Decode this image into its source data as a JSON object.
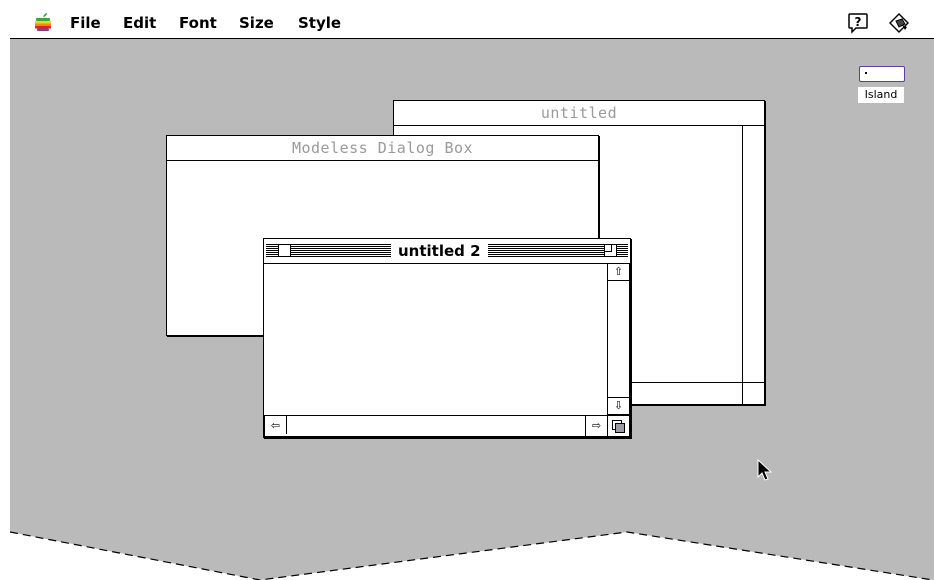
{
  "menubar": {
    "apple": "apple-icon",
    "items": [
      "File",
      "Edit",
      "Font",
      "Size",
      "Style"
    ],
    "right_icons": [
      "balloon-help-icon",
      "application-menu-icon"
    ]
  },
  "desktop": {
    "background": "#bababa",
    "disk_label": "Island",
    "disk_icon": "disk-icon"
  },
  "windows": {
    "back": {
      "title": "untitled"
    },
    "dialog": {
      "title": "Modeless Dialog Box"
    },
    "front": {
      "title": "untitled 2"
    }
  },
  "icons": [
    "close-box-icon",
    "zoom-box-icon",
    "scroll-up-arrow-icon",
    "scroll-down-arrow-icon",
    "scroll-left-arrow-icon",
    "scroll-right-arrow-icon",
    "grow-box-icon",
    "arrow-cursor-icon"
  ]
}
